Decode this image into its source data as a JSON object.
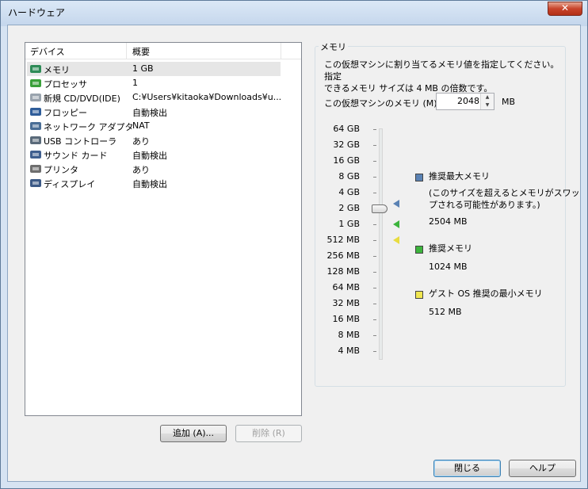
{
  "window": {
    "title": "ハードウェア",
    "close_label": "✕"
  },
  "devices": {
    "headers": {
      "device": "デバイス",
      "summary": "概要"
    },
    "items": [
      {
        "name": "メモリ",
        "value": "1 GB",
        "icon": "memory-icon"
      },
      {
        "name": "プロセッサ",
        "value": "1",
        "icon": "processor-icon"
      },
      {
        "name": "新規 CD/DVD(IDE)",
        "value": "C:¥Users¥kitaoka¥Downloads¥u...",
        "icon": "cd-dvd-icon"
      },
      {
        "name": "フロッピー",
        "value": "自動検出",
        "icon": "floppy-icon"
      },
      {
        "name": "ネットワーク アダプタ",
        "value": "NAT",
        "icon": "network-adapter-icon"
      },
      {
        "name": "USB コントローラ",
        "value": "あり",
        "icon": "usb-controller-icon"
      },
      {
        "name": "サウンド カード",
        "value": "自動検出",
        "icon": "sound-card-icon"
      },
      {
        "name": "プリンタ",
        "value": "あり",
        "icon": "printer-icon"
      },
      {
        "name": "ディスプレイ",
        "value": "自動検出",
        "icon": "display-icon"
      }
    ],
    "selected_index": 0
  },
  "buttons": {
    "add": "追加 (A)...",
    "remove": "削除 (R)",
    "close": "閉じる",
    "help": "ヘルプ"
  },
  "memory": {
    "group_title": "メモリ",
    "description_line1": "この仮想マシンに割り当てるメモリ値を指定してください。指定",
    "description_line2": "できるメモリ サイズは 4 MB の倍数です。",
    "field_label": "この仮想マシンのメモリ (M):",
    "value": "2048",
    "unit": "MB",
    "scale_labels": [
      "64 GB",
      "32 GB",
      "16 GB",
      "8 GB",
      "4 GB",
      "2 GB",
      "1 GB",
      "512 MB",
      "256 MB",
      "128 MB",
      "64 MB",
      "32 MB",
      "16 MB",
      "8 MB",
      "4 MB"
    ],
    "slider_value_mb": 2048,
    "legend": [
      {
        "title": "推奨最大メモリ",
        "note_line1": "(このサイズを超えるとメモリがスワッ",
        "note_line2": "プされる可能性があります。)",
        "value": "2504 MB",
        "color": "#5a82b4"
      },
      {
        "title": "推奨メモリ",
        "value": "1024 MB",
        "color": "#3cb43c"
      },
      {
        "title": "ゲスト OS 推奨の最小メモリ",
        "value": "512 MB",
        "color": "#f0e650"
      }
    ]
  },
  "icons": {
    "spin_up": "▲",
    "spin_down": "▼"
  }
}
